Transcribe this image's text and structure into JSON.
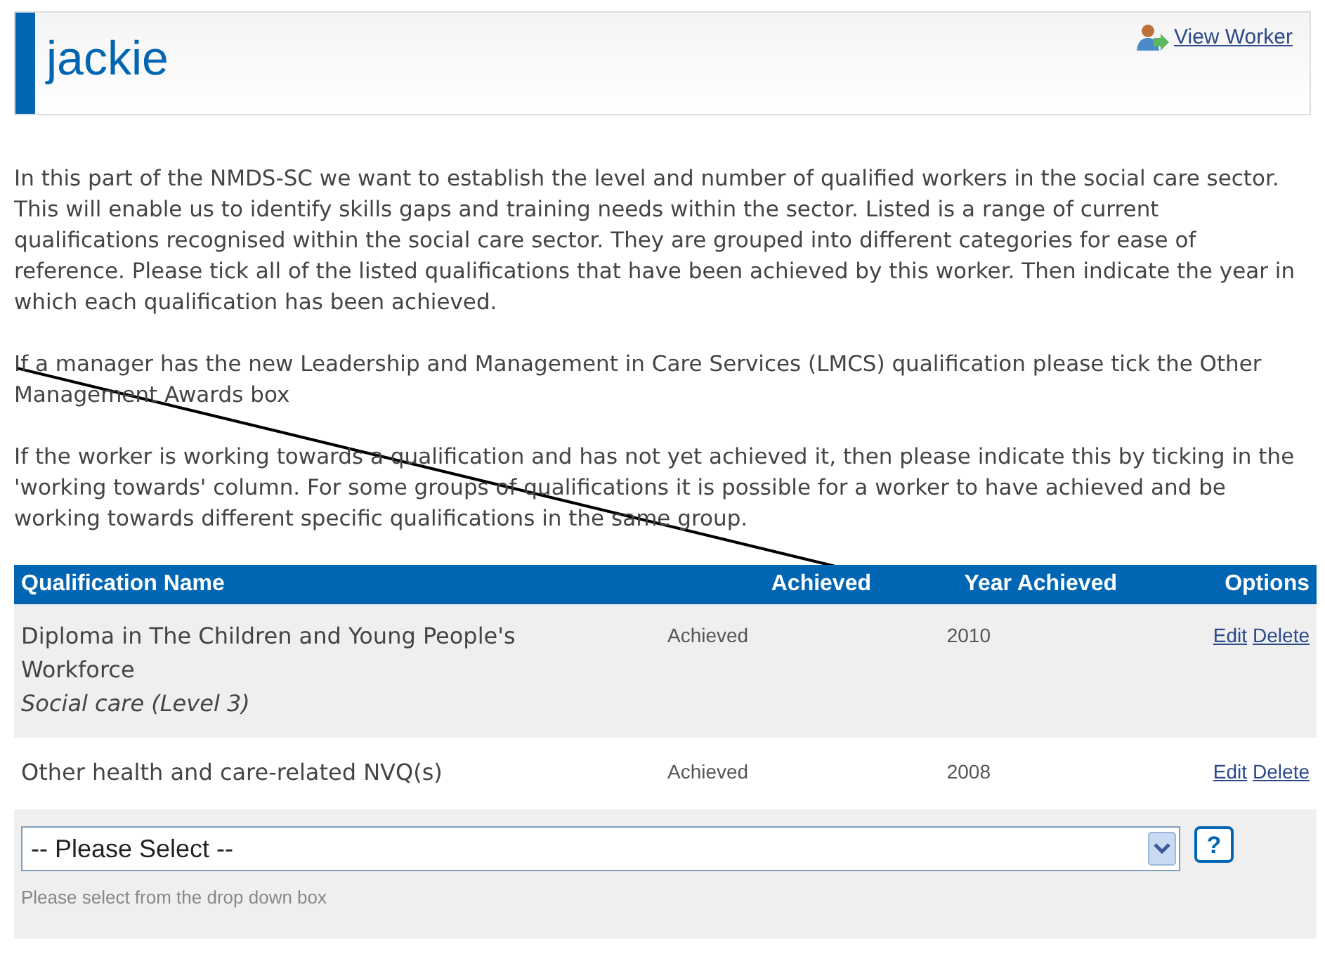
{
  "header": {
    "title": "jackie",
    "link": "View Worker"
  },
  "paragraphs": [
    "In this part of the NMDS-SC we want to establish the level and number of qualified workers in the social care sector. This will enable us to identify skills gaps and training needs within the sector. Listed is a range of current qualifications recognised within the social care sector. They are grouped into different categories for ease of reference. Please tick all of the listed qualifications that have been achieved by this worker. Then indicate the year in which each qualification has been achieved.",
    "If a manager has the new Leadership and Management in Care Services (LMCS) qualification please tick the Other Management Awards box",
    "If the worker is working towards a qualification and has not yet achieved it, then please indicate this by ticking in the 'working towards' column. For some groups of qualifications it is possible for a worker to have achieved and be working towards different specific qualifications in the same group."
  ],
  "table": {
    "columns": [
      "Qualification Name",
      "Achieved",
      "Year Achieved",
      "Options"
    ],
    "rows": [
      {
        "name": "Diploma in The Children and Young People's Workforce",
        "subtitle": "Social care (Level 3)",
        "achieved": "Achieved",
        "year": "2010",
        "actions": [
          "Edit",
          "Delete"
        ]
      },
      {
        "name": "Other health and care-related NVQ(s)",
        "achieved": "Achieved",
        "year": "2008",
        "actions": [
          "Edit",
          "Delete"
        ]
      }
    ]
  },
  "select": {
    "value": "-- Please Select --",
    "help_button": "?",
    "hint": "Please select from the drop down box"
  }
}
